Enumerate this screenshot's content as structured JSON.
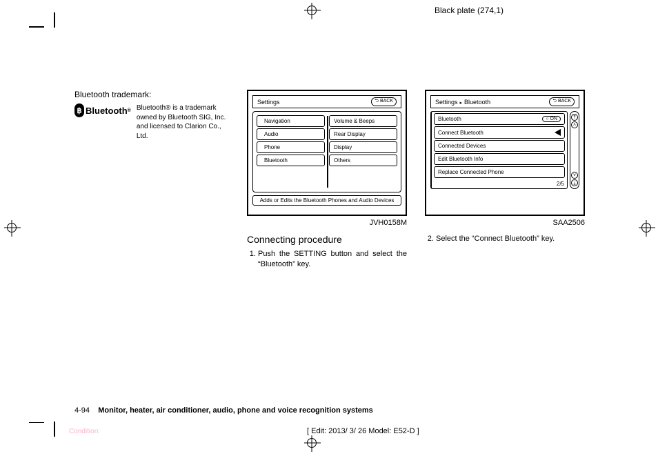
{
  "header": {
    "plate": "Black plate (274,1)"
  },
  "col1": {
    "title": "Bluetooth trademark:",
    "logo_text": "Bluetooth",
    "logo_reg": "®",
    "trademark_text": "Bluetooth® is a trademark owned by Bluetooth SIG, Inc. and licensed to Clarion Co., Ltd."
  },
  "fig1": {
    "title": "Settings",
    "back": "BACK",
    "left": [
      "Navigation",
      "Audio",
      "Phone",
      "Bluetooth"
    ],
    "right": [
      "Volume & Beeps",
      "Rear Display",
      "Display",
      "Others"
    ],
    "footer": "Adds or Edits the Bluetooth Phones and Audio Devices",
    "label": "JVH0158M"
  },
  "fig2": {
    "crumb1": "Settings",
    "crumb2": "Bluetooth",
    "back": "BACK",
    "items": [
      {
        "label": "Bluetooth",
        "badge": "ON"
      },
      {
        "label": "Connect Bluetooth",
        "highlight": true
      },
      {
        "label": "Connected Devices"
      },
      {
        "label": "Edit Bluetooth Info"
      },
      {
        "label": "Replace Connected Phone"
      }
    ],
    "counter": "2/5",
    "label": "SAA2506"
  },
  "col2_subhead": "Connecting procedure",
  "step1": "Push the SETTING button and select the “Bluetooth” key.",
  "step2": "Select the “Connect Bluetooth” key.",
  "footer": {
    "page": "4-94",
    "section": "Monitor, heater, air conditioner, audio, phone and voice recognition systems",
    "condition": "Condition:",
    "edit": "[ Edit: 2013/ 3/ 26   Model:  E52-D ]"
  }
}
